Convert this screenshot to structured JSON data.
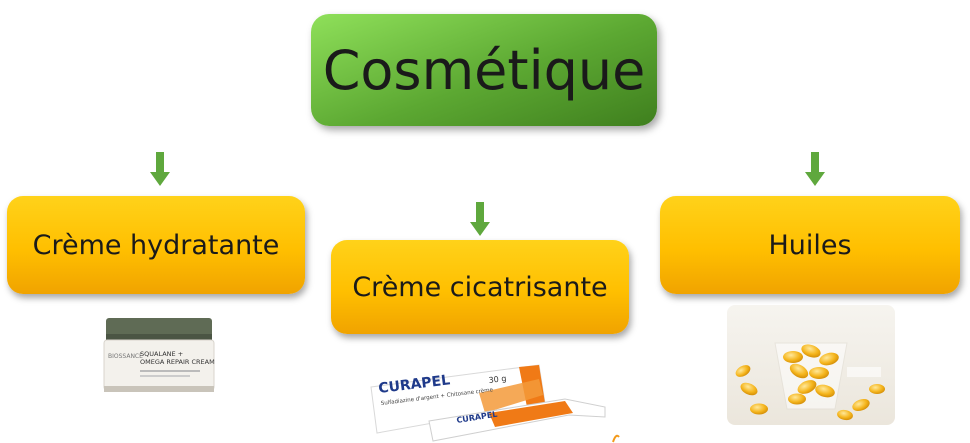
{
  "root": {
    "label": "Cosmétique"
  },
  "branches": [
    {
      "label": "Crème hydratante",
      "image": "cream-jar-image"
    },
    {
      "label": "Crème cicatrisante",
      "image": "curapel-tube-image"
    },
    {
      "label": "Huiles",
      "image": "oil-capsules-image"
    }
  ],
  "product_text": {
    "jar_brand": "BIOSSANCE",
    "jar_line1": "SQUALANE +",
    "jar_line2": "OMEGA REPAIR CREAM",
    "tube_brand": "CURAPEL",
    "tube_sub": "Sulfadiazine d'argent + Chitosane crème",
    "tube_size": "30 g"
  },
  "colors": {
    "root": "#5ca832",
    "branch": "#ffc000",
    "arrow": "#5fa83d"
  }
}
